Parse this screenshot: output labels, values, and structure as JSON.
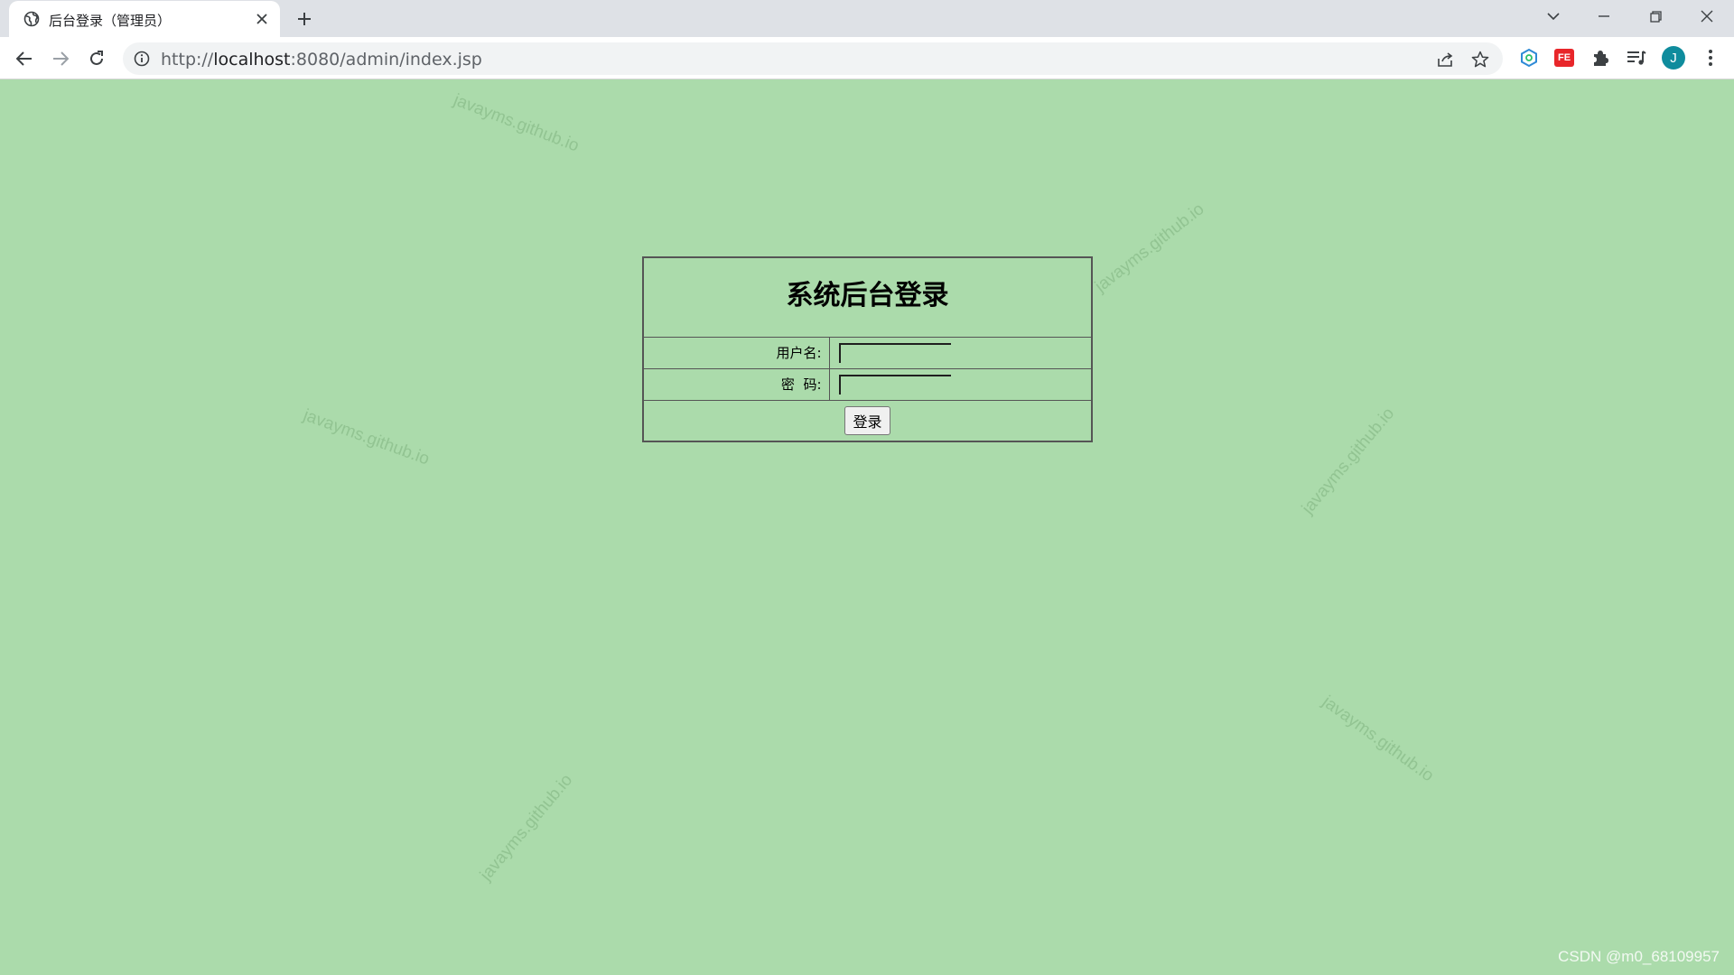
{
  "browser": {
    "tab": {
      "title": "后台登录（管理员）",
      "favicon": "globe-icon"
    },
    "url": {
      "scheme": "http://",
      "host": "localhost",
      "rest": ":8080/admin/index.jsp"
    },
    "avatar_letter": "J",
    "extensions": [
      "hexagon-extension-icon",
      "fe-extension-icon",
      "puzzle-extensions-icon",
      "reading-list-icon"
    ],
    "fe_label": "FE"
  },
  "login": {
    "title": "系统后台登录",
    "username_label": "用户名:",
    "password_label": "密  码:",
    "username_value": "",
    "password_value": "",
    "submit_label": "登录"
  },
  "watermark_text": "javayms.github.io",
  "attribution": "CSDN @m0_68109957",
  "colors": {
    "page_background": "#abdbab",
    "border": "#555555",
    "tab_strip": "#dee1e6"
  }
}
